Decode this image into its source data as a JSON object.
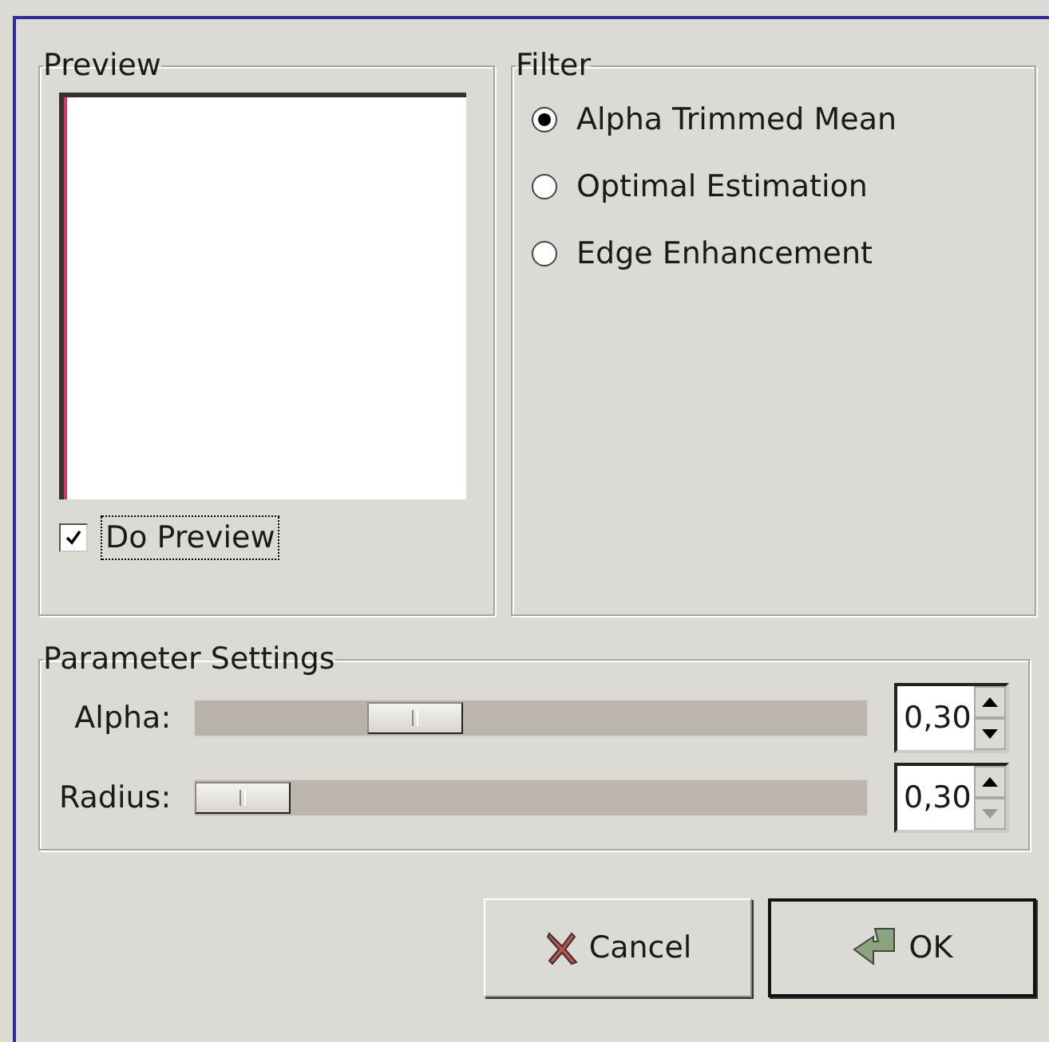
{
  "preview": {
    "title": "Preview",
    "checkbox": {
      "label": "Do Preview",
      "checked": true
    }
  },
  "filter": {
    "title": "Filter",
    "options": [
      {
        "label": "Alpha Trimmed Mean",
        "selected": true
      },
      {
        "label": "Optimal Estimation",
        "selected": false
      },
      {
        "label": "Edge Enhancement",
        "selected": false
      }
    ]
  },
  "parameters": {
    "title": "Parameter Settings",
    "rows": [
      {
        "label": "Alpha:",
        "level": 0.3,
        "value": "0,30",
        "up_disabled": false,
        "down_disabled": false
      },
      {
        "label": "Radius:",
        "level": 0,
        "value": "0,30",
        "up_disabled": false,
        "down_disabled": true
      }
    ]
  },
  "buttons": [
    {
      "kind": "cancel",
      "label": "Cancel",
      "default": false
    },
    {
      "kind": "ok",
      "label": "OK",
      "default": true
    }
  ]
}
